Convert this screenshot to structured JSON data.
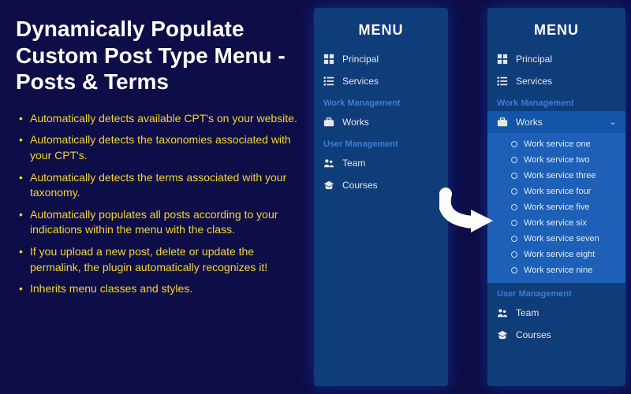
{
  "title": "Dynamically Populate Custom Post Type Menu - Posts & Terms",
  "bullets": [
    "Automatically detects available CPT's on your website.",
    "Automatically detects the taxonomies associated with your CPT's.",
    "Automatically detects the terms associated with your taxonomy.",
    "Automatically populates all posts according to your indications within the menu with the class.",
    "If you upload a new post, delete or update the permalink, the plugin automatically recognizes it!",
    "Inherits menu classes and styles."
  ],
  "panelA": {
    "header": "MENU",
    "items": {
      "principal": "Principal",
      "services": "Services"
    },
    "sections": {
      "work": "Work Management",
      "user": "User Management"
    },
    "work_items": {
      "works": "Works"
    },
    "user_items": {
      "team": "Team",
      "courses": "Courses"
    }
  },
  "panelB": {
    "header": "MENU",
    "items": {
      "principal": "Principal",
      "services": "Services"
    },
    "sections": {
      "work": "Work Management",
      "user": "User Management"
    },
    "work_items": {
      "works": "Works"
    },
    "submenu": [
      "Work service one",
      "Work service two",
      "Work service three",
      "Work service four",
      "Work service five",
      "Work service six",
      "Work service seven",
      "Work service eight",
      "Work service nine"
    ],
    "user_items": {
      "team": "Team",
      "courses": "Courses"
    }
  }
}
